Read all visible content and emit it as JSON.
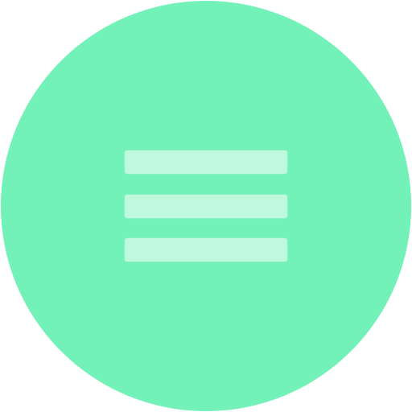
{
  "menu_button": {
    "icon": "hamburger-menu-icon",
    "color": "#72f1b9",
    "icon_color": "#bef8dd"
  }
}
